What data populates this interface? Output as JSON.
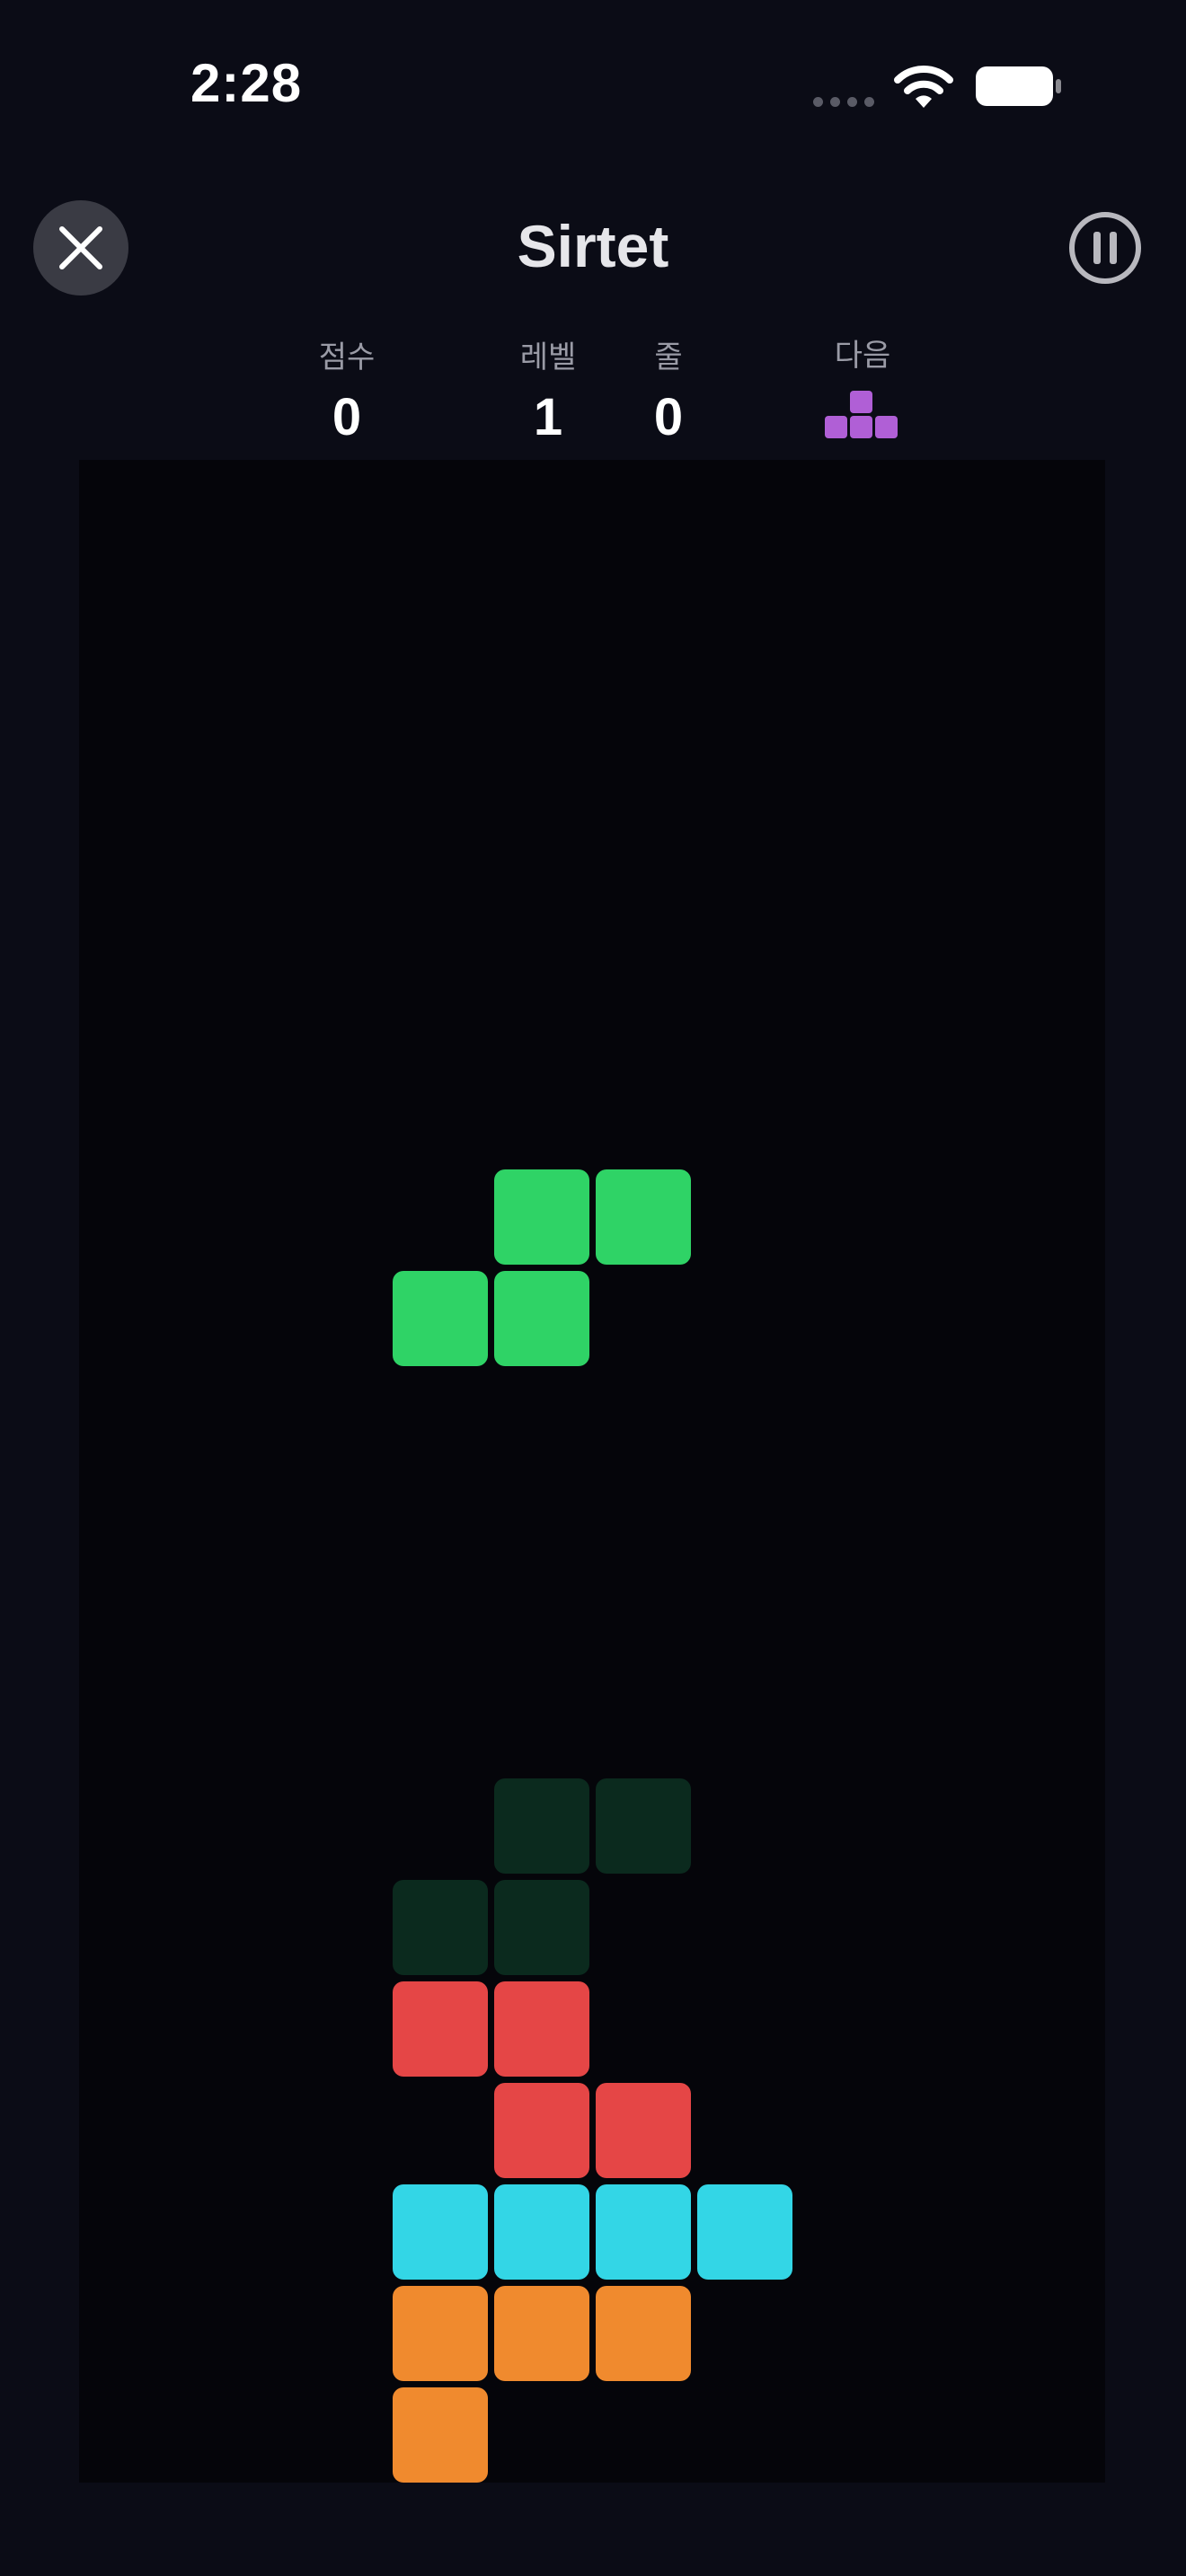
{
  "status_bar": {
    "time": "2:28"
  },
  "header": {
    "title": "Sirtet"
  },
  "stats": {
    "score_label": "점수",
    "score_value": "0",
    "level_label": "레벨",
    "level_value": "1",
    "lines_label": "줄",
    "lines_value": "0",
    "next_label": "다음"
  },
  "next_piece": {
    "shape": "T",
    "color": "#b05fd6"
  },
  "colors": {
    "green": "#2fd366",
    "ghost": "#0b2a1e",
    "red": "#e54646",
    "cyan": "#33d6e6",
    "orange": "#f08a2e",
    "board_bg": "#05050a",
    "screen_bg": "#0b0c16"
  },
  "board": {
    "columns": 10,
    "active_piece": {
      "shape": "S",
      "color": "green",
      "cells": [
        [
          4,
          0
        ],
        [
          5,
          0
        ],
        [
          3,
          1
        ],
        [
          4,
          1
        ]
      ]
    },
    "ghost_piece": {
      "shape": "S",
      "color": "ghost",
      "cells": [
        [
          4,
          6
        ],
        [
          5,
          6
        ],
        [
          3,
          7
        ],
        [
          4,
          7
        ]
      ]
    },
    "locked_cells": [
      {
        "col": 3,
        "row": 8,
        "color": "red"
      },
      {
        "col": 4,
        "row": 8,
        "color": "red"
      },
      {
        "col": 4,
        "row": 9,
        "color": "red"
      },
      {
        "col": 5,
        "row": 9,
        "color": "red"
      },
      {
        "col": 3,
        "row": 10,
        "color": "cyan"
      },
      {
        "col": 4,
        "row": 10,
        "color": "cyan"
      },
      {
        "col": 5,
        "row": 10,
        "color": "cyan"
      },
      {
        "col": 6,
        "row": 10,
        "color": "cyan"
      },
      {
        "col": 3,
        "row": 11,
        "color": "orange"
      },
      {
        "col": 4,
        "row": 11,
        "color": "orange"
      },
      {
        "col": 5,
        "row": 11,
        "color": "orange"
      },
      {
        "col": 3,
        "row": 12,
        "color": "orange"
      }
    ]
  }
}
